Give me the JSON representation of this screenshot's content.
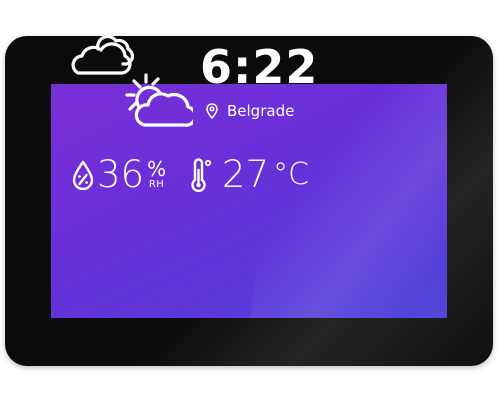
{
  "display": {
    "time": "6:22",
    "location": "Belgrade",
    "humidity": {
      "value": "36",
      "percent_symbol": "%",
      "label": "RH"
    },
    "temperature": {
      "value": "27",
      "unit": "°C"
    }
  },
  "icons": {
    "weather": "partly-cloudy-sun-with-cloud-icon",
    "location": "map-pin-icon",
    "humidity": "humidity-drop-icon",
    "temperature": "thermometer-icon"
  },
  "colors": {
    "bezel": "#0b0b0c",
    "screen_top": "#7a2fd6",
    "screen_bottom": "#5147d9",
    "text": "#ffffff"
  }
}
